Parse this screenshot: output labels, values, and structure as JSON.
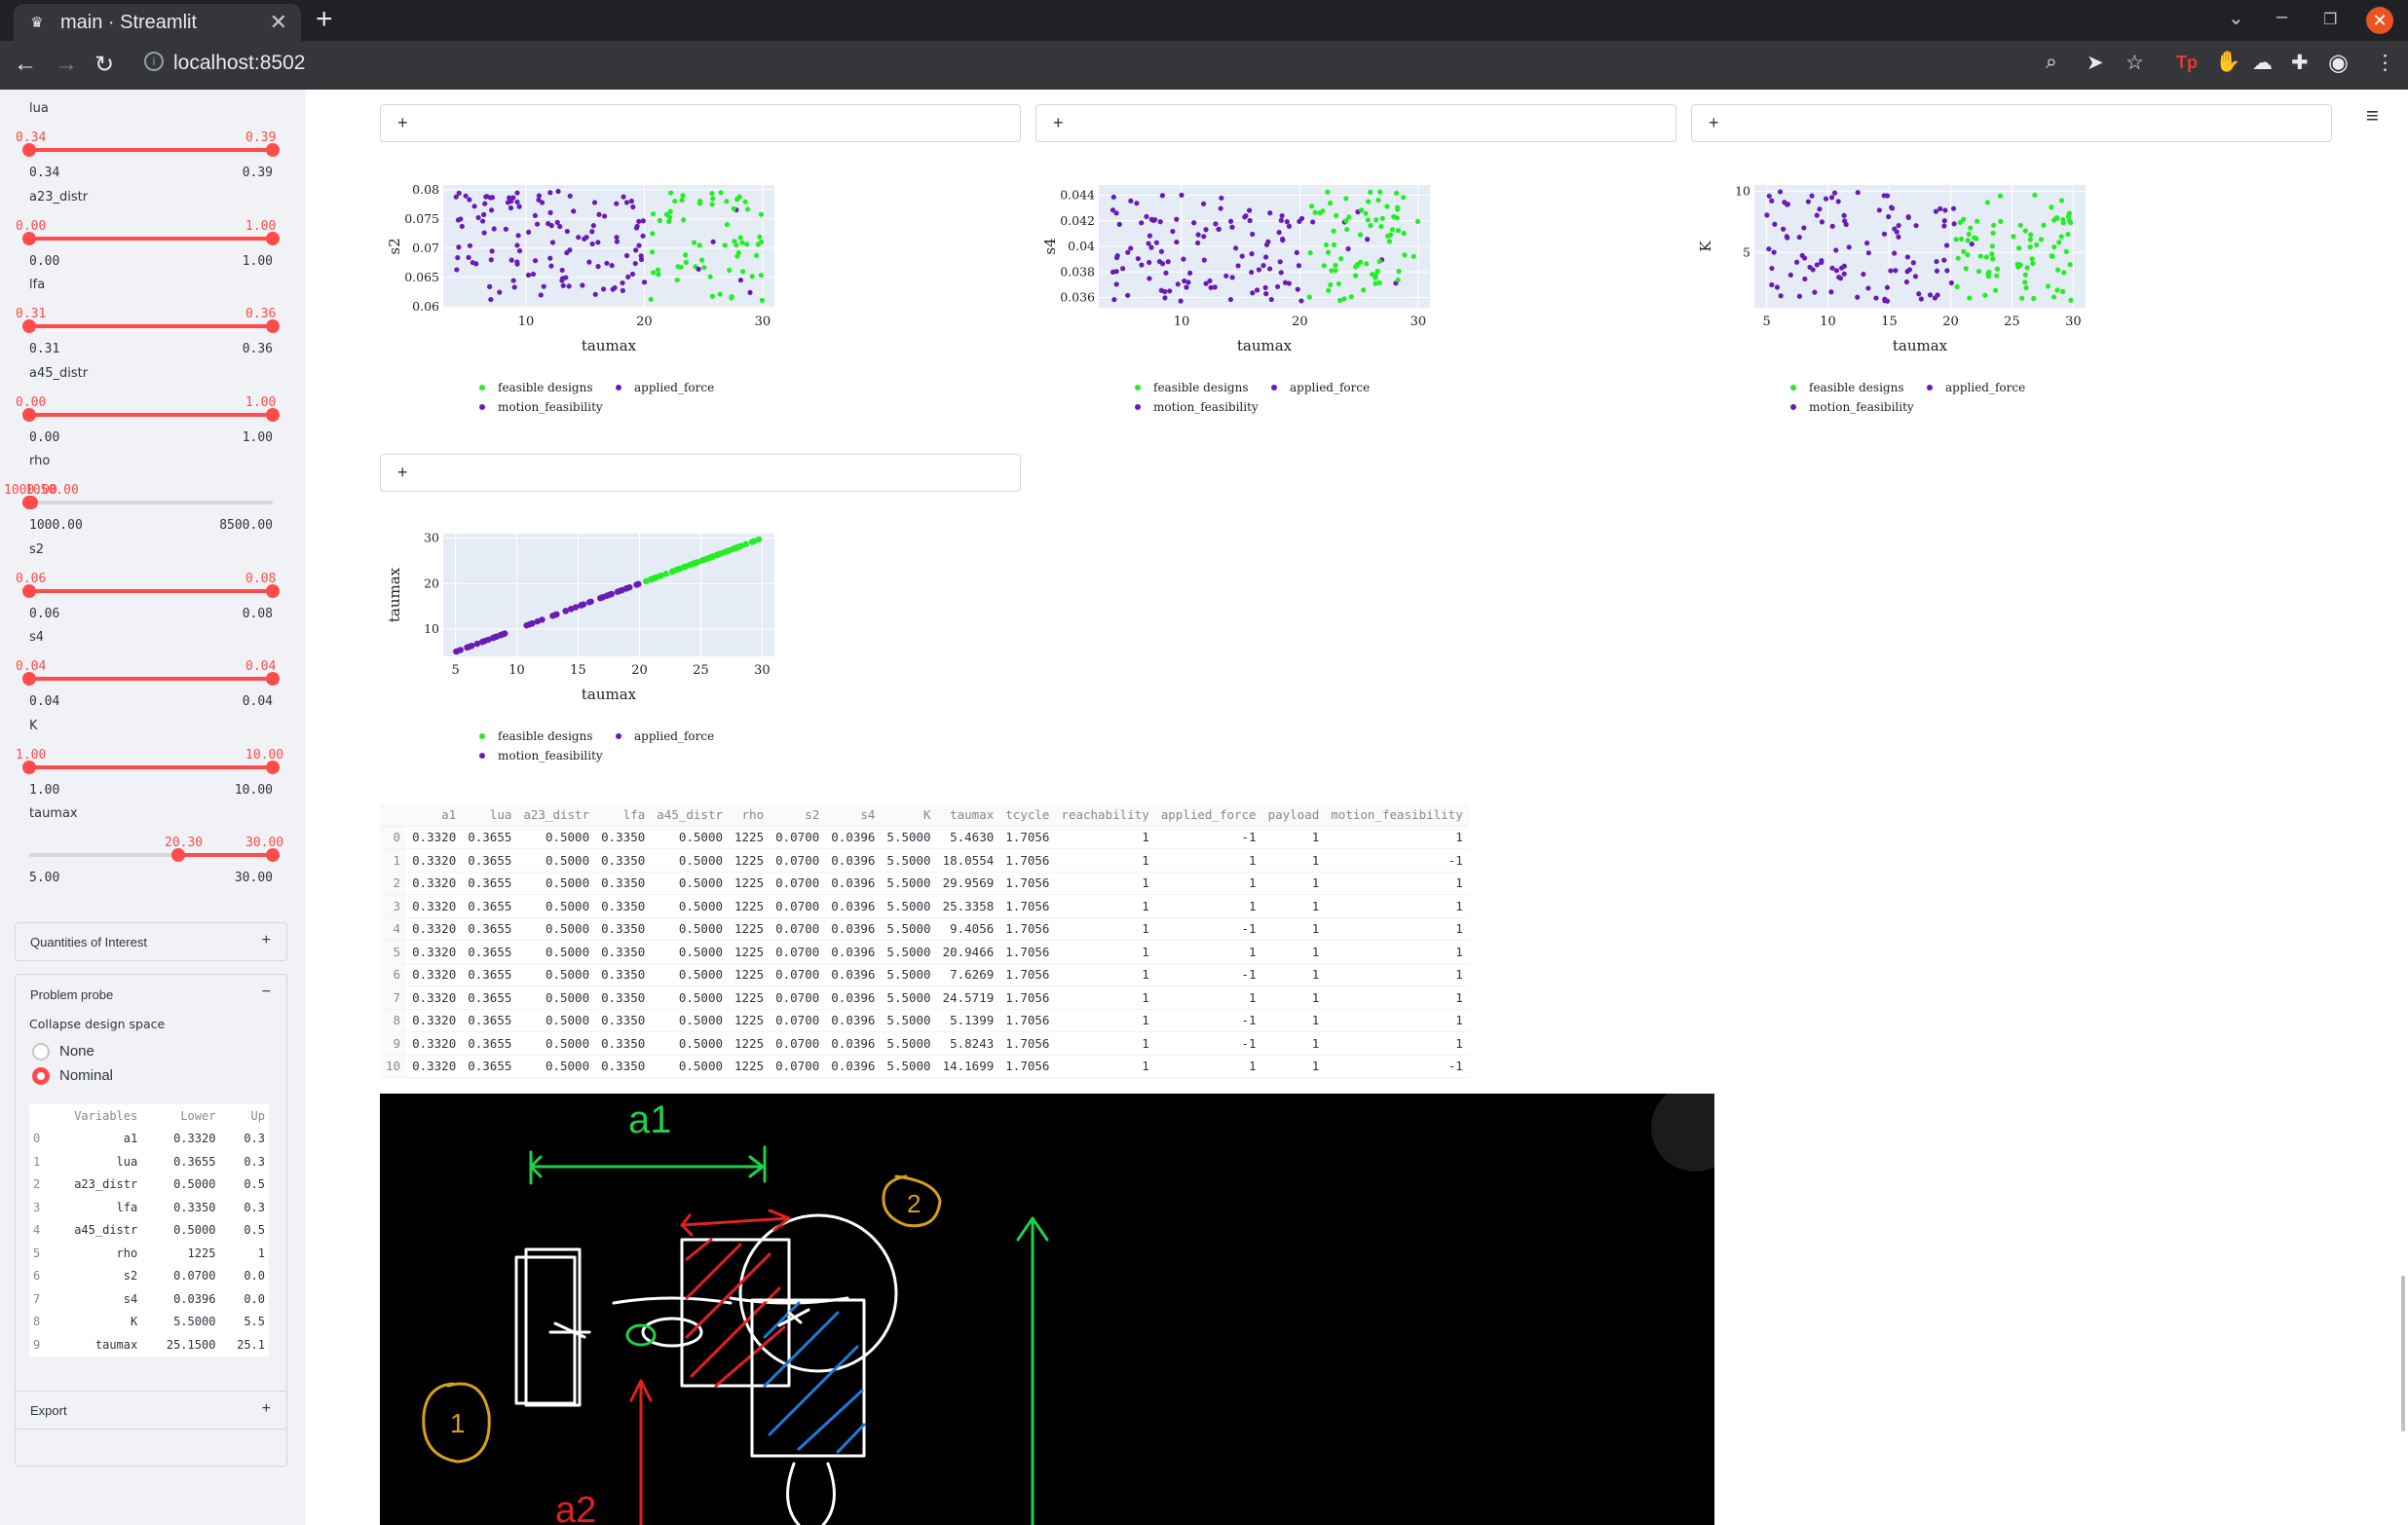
{
  "browser": {
    "tab_title": "main · Streamlit",
    "url": "localhost:8502"
  },
  "sidebar": {
    "sliders": [
      {
        "label": "lua",
        "lo_sel": "0.34",
        "hi_sel": "0.39",
        "min": "0.34",
        "max": "0.39",
        "lo_frac": 0.0,
        "hi_frac": 1.0
      },
      {
        "label": "a23_distr",
        "lo_sel": "0.00",
        "hi_sel": "1.00",
        "min": "0.00",
        "max": "1.00",
        "lo_frac": 0.0,
        "hi_frac": 1.0
      },
      {
        "label": "lfa",
        "lo_sel": "0.31",
        "hi_sel": "0.36",
        "min": "0.31",
        "max": "0.36",
        "lo_frac": 0.0,
        "hi_frac": 1.0
      },
      {
        "label": "a45_distr",
        "lo_sel": "0.00",
        "hi_sel": "1.00",
        "min": "0.00",
        "max": "1.00",
        "lo_frac": 0.0,
        "hi_frac": 1.0
      },
      {
        "label": "rho",
        "lo_sel": "1000.00",
        "hi_sel": "1050.00",
        "min": "1000.00",
        "max": "8500.00",
        "lo_frac": 0.0,
        "hi_frac": 0.007
      },
      {
        "label": "s2",
        "lo_sel": "0.06",
        "hi_sel": "0.08",
        "min": "0.06",
        "max": "0.08",
        "lo_frac": 0.0,
        "hi_frac": 1.0
      },
      {
        "label": "s4",
        "lo_sel": "0.04",
        "hi_sel": "0.04",
        "min": "0.04",
        "max": "0.04",
        "lo_frac": 0.0,
        "hi_frac": 1.0
      },
      {
        "label": "K",
        "lo_sel": "1.00",
        "hi_sel": "10.00",
        "min": "1.00",
        "max": "10.00",
        "lo_frac": 0.0,
        "hi_frac": 1.0
      },
      {
        "label": "taumax",
        "lo_sel": "20.30",
        "hi_sel": "30.00",
        "min": "5.00",
        "max": "30.00",
        "lo_frac": 0.612,
        "hi_frac": 1.0
      }
    ],
    "qoi": {
      "label": "Quantities of Interest",
      "toggle": "+"
    },
    "probe": {
      "label": "Problem probe",
      "toggle": "−",
      "collapse_label": "Collapse design space",
      "options": [
        "None",
        "Nominal"
      ],
      "selected": "Nominal",
      "table": {
        "headers": [
          "",
          "Variables",
          "Lower",
          "Up"
        ],
        "rows": [
          [
            "0",
            "a1",
            "0.3320",
            "0.3"
          ],
          [
            "1",
            "lua",
            "0.3655",
            "0.3"
          ],
          [
            "2",
            "a23_distr",
            "0.5000",
            "0.5"
          ],
          [
            "3",
            "lfa",
            "0.3350",
            "0.3"
          ],
          [
            "4",
            "a45_distr",
            "0.5000",
            "0.5"
          ],
          [
            "5",
            "rho",
            "1225",
            "1"
          ],
          [
            "6",
            "s2",
            "0.0700",
            "0.0"
          ],
          [
            "7",
            "s4",
            "0.0396",
            "0.0"
          ],
          [
            "8",
            "K",
            "5.5000",
            "5.5"
          ],
          [
            "9",
            "taumax",
            "25.1500",
            "25.1"
          ]
        ]
      }
    },
    "export": {
      "label": "Export",
      "toggle": "+"
    }
  },
  "main": {
    "plus": "+",
    "menu": "≡",
    "legend": {
      "a": "feasible designs",
      "b": "applied_force",
      "c": "motion_feasibility"
    },
    "colors": {
      "feasible": "#22ee22",
      "infeasible": "#6a1bb5",
      "grid": "#e5ecf6"
    },
    "table": {
      "headers": [
        "",
        "a1",
        "lua",
        "a23_distr",
        "lfa",
        "a45_distr",
        "rho",
        "s2",
        "s4",
        "K",
        "taumax",
        "tcycle",
        "reachability",
        "applied_force",
        "payload",
        "motion_feasibility"
      ],
      "rows": [
        [
          "0",
          "0.3320",
          "0.3655",
          "0.5000",
          "0.3350",
          "0.5000",
          "1225",
          "0.0700",
          "0.0396",
          "5.5000",
          "5.4630",
          "1.7056",
          "1",
          "-1",
          "1",
          "1"
        ],
        [
          "1",
          "0.3320",
          "0.3655",
          "0.5000",
          "0.3350",
          "0.5000",
          "1225",
          "0.0700",
          "0.0396",
          "5.5000",
          "18.0554",
          "1.7056",
          "1",
          "1",
          "1",
          "-1"
        ],
        [
          "2",
          "0.3320",
          "0.3655",
          "0.5000",
          "0.3350",
          "0.5000",
          "1225",
          "0.0700",
          "0.0396",
          "5.5000",
          "29.9569",
          "1.7056",
          "1",
          "1",
          "1",
          "1"
        ],
        [
          "3",
          "0.3320",
          "0.3655",
          "0.5000",
          "0.3350",
          "0.5000",
          "1225",
          "0.0700",
          "0.0396",
          "5.5000",
          "25.3358",
          "1.7056",
          "1",
          "1",
          "1",
          "1"
        ],
        [
          "4",
          "0.3320",
          "0.3655",
          "0.5000",
          "0.3350",
          "0.5000",
          "1225",
          "0.0700",
          "0.0396",
          "5.5000",
          "9.4056",
          "1.7056",
          "1",
          "-1",
          "1",
          "1"
        ],
        [
          "5",
          "0.3320",
          "0.3655",
          "0.5000",
          "0.3350",
          "0.5000",
          "1225",
          "0.0700",
          "0.0396",
          "5.5000",
          "20.9466",
          "1.7056",
          "1",
          "1",
          "1",
          "1"
        ],
        [
          "6",
          "0.3320",
          "0.3655",
          "0.5000",
          "0.3350",
          "0.5000",
          "1225",
          "0.0700",
          "0.0396",
          "5.5000",
          "7.6269",
          "1.7056",
          "1",
          "-1",
          "1",
          "1"
        ],
        [
          "7",
          "0.3320",
          "0.3655",
          "0.5000",
          "0.3350",
          "0.5000",
          "1225",
          "0.0700",
          "0.0396",
          "5.5000",
          "24.5719",
          "1.7056",
          "1",
          "1",
          "1",
          "1"
        ],
        [
          "8",
          "0.3320",
          "0.3655",
          "0.5000",
          "0.3350",
          "0.5000",
          "1225",
          "0.0700",
          "0.0396",
          "5.5000",
          "5.1399",
          "1.7056",
          "1",
          "-1",
          "1",
          "1"
        ],
        [
          "9",
          "0.3320",
          "0.3655",
          "0.5000",
          "0.3350",
          "0.5000",
          "1225",
          "0.0700",
          "0.0396",
          "5.5000",
          "5.8243",
          "1.7056",
          "1",
          "-1",
          "1",
          "1"
        ],
        [
          "10",
          "0.3320",
          "0.3655",
          "0.5000",
          "0.3350",
          "0.5000",
          "1225",
          "0.0700",
          "0.0396",
          "5.5000",
          "14.1699",
          "1.7056",
          "1",
          "1",
          "1",
          "-1"
        ]
      ]
    },
    "sketch": {
      "label_a1": "a1",
      "label_a2": "a2",
      "num1": "1",
      "num2": "2"
    }
  },
  "chart_data": [
    {
      "type": "scatter",
      "xlabel": "taumax",
      "ylabel": "s2",
      "xlim": [
        3,
        31
      ],
      "ylim": [
        0.0598,
        0.0808
      ],
      "xticks": [
        "10",
        "20",
        "30"
      ],
      "yticks": [
        "0.06",
        "0.065",
        "0.07",
        "0.075",
        "0.08"
      ],
      "ytick_values": [
        0.06,
        0.065,
        0.07,
        0.075,
        0.08
      ],
      "xtick_values": [
        10,
        20,
        30
      ],
      "series": [
        {
          "name": "feasible designs",
          "seed": 11
        },
        {
          "name": "applied_force",
          "seed": 12
        },
        {
          "name": "motion_feasibility",
          "seed": 13
        }
      ]
    },
    {
      "type": "scatter",
      "xlabel": "taumax",
      "ylabel": "s4",
      "xlim": [
        3,
        31
      ],
      "ylim": [
        0.0352,
        0.0448
      ],
      "xticks": [
        "10",
        "20",
        "30"
      ],
      "yticks": [
        "0.036",
        "0.038",
        "0.04",
        "0.042",
        "0.044"
      ],
      "ytick_values": [
        0.036,
        0.038,
        0.04,
        0.042,
        0.044
      ],
      "xtick_values": [
        10,
        20,
        30
      ],
      "series": [
        {
          "name": "feasible designs",
          "seed": 21
        },
        {
          "name": "applied_force",
          "seed": 22
        },
        {
          "name": "motion_feasibility",
          "seed": 23
        }
      ]
    },
    {
      "type": "scatter",
      "xlabel": "taumax",
      "ylabel": "K",
      "xlim": [
        4,
        31
      ],
      "ylim": [
        0.5,
        10.5
      ],
      "xticks": [
        "5",
        "10",
        "15",
        "20",
        "25",
        "30"
      ],
      "yticks": [
        "5",
        "10"
      ],
      "ytick_values": [
        5,
        10
      ],
      "xtick_values": [
        5,
        10,
        15,
        20,
        25,
        30
      ],
      "series": [
        {
          "name": "feasible designs",
          "seed": 31
        },
        {
          "name": "applied_force",
          "seed": 32
        },
        {
          "name": "motion_feasibility",
          "seed": 33
        }
      ]
    },
    {
      "type": "scatter",
      "xlabel": "taumax",
      "ylabel": "taumax",
      "xlim": [
        4,
        31
      ],
      "ylim": [
        4,
        31
      ],
      "xticks": [
        "5",
        "10",
        "15",
        "20",
        "25",
        "30"
      ],
      "yticks": [
        "10",
        "20",
        "30"
      ],
      "ytick_values": [
        10,
        20,
        30
      ],
      "xtick_values": [
        5,
        10,
        15,
        20,
        25,
        30
      ],
      "diagonal": true,
      "series": [
        {
          "name": "feasible designs",
          "seed": 41
        },
        {
          "name": "applied_force",
          "seed": 42
        },
        {
          "name": "motion_feasibility",
          "seed": 43
        }
      ]
    }
  ]
}
